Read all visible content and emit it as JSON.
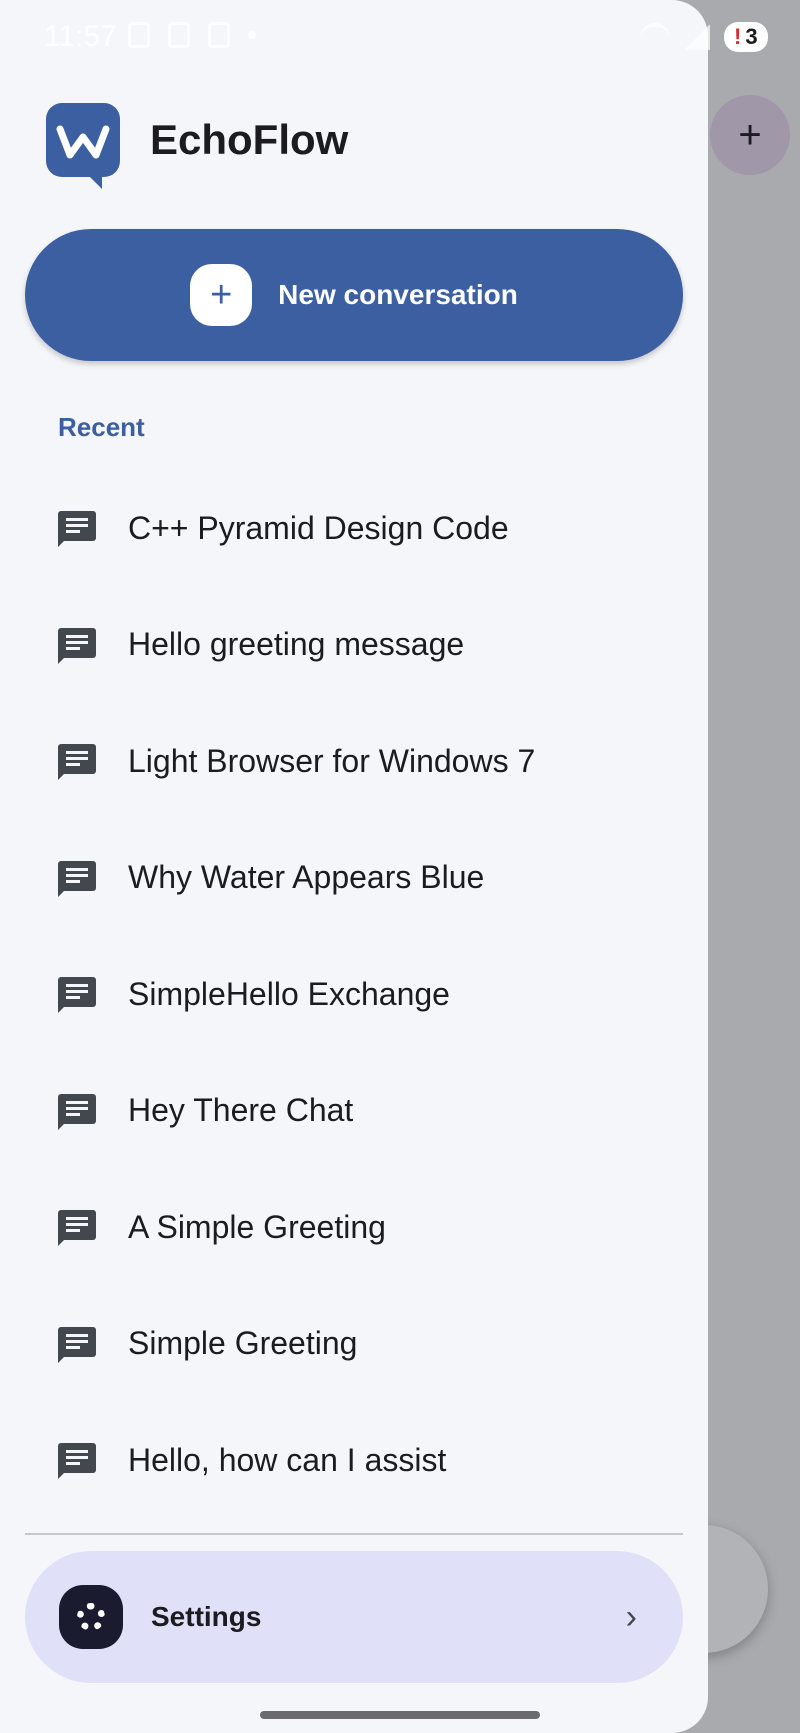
{
  "status_bar": {
    "time": "11:57",
    "notification_count": "3"
  },
  "app": {
    "name": "EchoFlow"
  },
  "new_conversation": {
    "label": "New conversation",
    "icon": "plus-icon"
  },
  "recent": {
    "title": "Recent",
    "items": [
      {
        "label": "C++ Pyramid Design Code"
      },
      {
        "label": "Hello greeting message"
      },
      {
        "label": "Light Browser for Windows 7"
      },
      {
        "label": "Why Water Appears Blue"
      },
      {
        "label": "SimpleHello Exchange"
      },
      {
        "label": "Hey There Chat"
      },
      {
        "label": "A Simple Greeting"
      },
      {
        "label": "Simple Greeting"
      },
      {
        "label": "Hello, how can I assist"
      }
    ]
  },
  "settings": {
    "label": "Settings",
    "icon": "gear-icon"
  },
  "colors": {
    "primary": "#3b5fa0",
    "drawer_bg": "#f5f6fa",
    "settings_bg": "#e1e0f9"
  }
}
